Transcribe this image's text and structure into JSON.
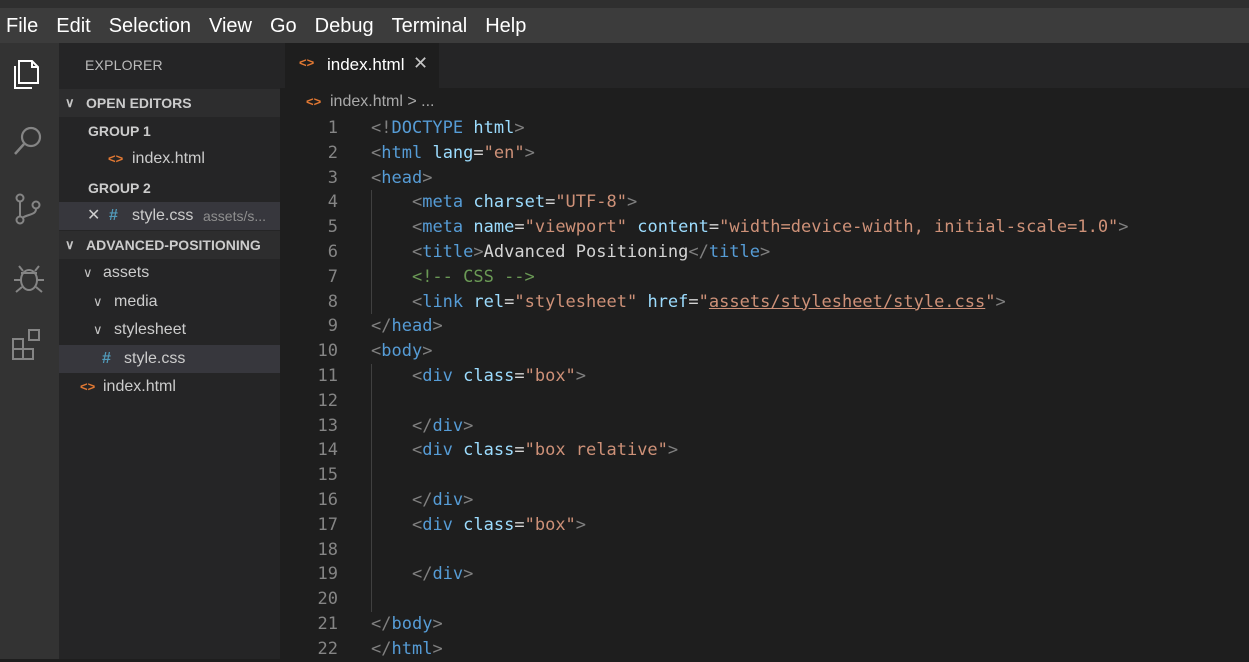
{
  "menu": [
    "File",
    "Edit",
    "Selection",
    "View",
    "Go",
    "Debug",
    "Terminal",
    "Help"
  ],
  "explorer": {
    "title": "EXPLORER",
    "open_editors": "OPEN EDITORS",
    "group1": "GROUP 1",
    "group1_file": "index.html",
    "group2": "GROUP 2",
    "group2_file": "style.css",
    "group2_desc": "assets/s...",
    "folder": "ADVANCED-POSITIONING",
    "tree": {
      "assets": "assets",
      "media": "media",
      "stylesheet": "stylesheet",
      "style": "style.css",
      "index": "index.html"
    }
  },
  "tab": {
    "label": "index.html"
  },
  "breadcrumb": "index.html > ...",
  "icons": {
    "html": "<>",
    "css": "#",
    "chevron_down": "chevron-down-icon",
    "close": "close-icon"
  },
  "colors": {
    "tag": "#569cd6",
    "attr": "#9cdcfe",
    "string": "#ce9178",
    "comment": "#6a9955",
    "punct": "#808080"
  },
  "code": [
    [
      [
        "p",
        "<!"
      ],
      [
        "t",
        "DOCTYPE"
      ],
      [
        "x",
        " "
      ],
      [
        "a",
        "html"
      ],
      [
        "p",
        ">"
      ]
    ],
    [
      [
        "p",
        "<"
      ],
      [
        "t",
        "html"
      ],
      [
        "x",
        " "
      ],
      [
        "a",
        "lang"
      ],
      [
        "x",
        "="
      ],
      [
        "s",
        "\"en\""
      ],
      [
        "p",
        ">"
      ]
    ],
    [
      [
        "p",
        "<"
      ],
      [
        "t",
        "head"
      ],
      [
        "p",
        ">"
      ]
    ],
    [
      [
        "x",
        "    "
      ],
      [
        "p",
        "<"
      ],
      [
        "t",
        "meta"
      ],
      [
        "x",
        " "
      ],
      [
        "a",
        "charset"
      ],
      [
        "x",
        "="
      ],
      [
        "s",
        "\"UTF-8\""
      ],
      [
        "p",
        ">"
      ]
    ],
    [
      [
        "x",
        "    "
      ],
      [
        "p",
        "<"
      ],
      [
        "t",
        "meta"
      ],
      [
        "x",
        " "
      ],
      [
        "a",
        "name"
      ],
      [
        "x",
        "="
      ],
      [
        "s",
        "\"viewport\""
      ],
      [
        "x",
        " "
      ],
      [
        "a",
        "content"
      ],
      [
        "x",
        "="
      ],
      [
        "s",
        "\"width=device-width, initial-scale=1.0\""
      ],
      [
        "p",
        ">"
      ]
    ],
    [
      [
        "x",
        "    "
      ],
      [
        "p",
        "<"
      ],
      [
        "t",
        "title"
      ],
      [
        "p",
        ">"
      ],
      [
        "x",
        "Advanced Positioning"
      ],
      [
        "p",
        "</"
      ],
      [
        "t",
        "title"
      ],
      [
        "p",
        ">"
      ]
    ],
    [
      [
        "x",
        "    "
      ],
      [
        "c",
        "<!-- CSS -->"
      ]
    ],
    [
      [
        "x",
        "    "
      ],
      [
        "p",
        "<"
      ],
      [
        "t",
        "link"
      ],
      [
        "x",
        " "
      ],
      [
        "a",
        "rel"
      ],
      [
        "x",
        "="
      ],
      [
        "s",
        "\"stylesheet\""
      ],
      [
        "x",
        " "
      ],
      [
        "a",
        "href"
      ],
      [
        "x",
        "="
      ],
      [
        "s",
        "\""
      ],
      [
        "u",
        "assets/stylesheet/style.css"
      ],
      [
        "s",
        "\""
      ],
      [
        "p",
        ">"
      ]
    ],
    [
      [
        "p",
        "</"
      ],
      [
        "t",
        "head"
      ],
      [
        "p",
        ">"
      ]
    ],
    [
      [
        "p",
        "<"
      ],
      [
        "t",
        "body"
      ],
      [
        "p",
        ">"
      ]
    ],
    [
      [
        "x",
        "    "
      ],
      [
        "p",
        "<"
      ],
      [
        "t",
        "div"
      ],
      [
        "x",
        " "
      ],
      [
        "a",
        "class"
      ],
      [
        "x",
        "="
      ],
      [
        "s",
        "\"box\""
      ],
      [
        "p",
        ">"
      ]
    ],
    [],
    [
      [
        "x",
        "    "
      ],
      [
        "p",
        "</"
      ],
      [
        "t",
        "div"
      ],
      [
        "p",
        ">"
      ]
    ],
    [
      [
        "x",
        "    "
      ],
      [
        "p",
        "<"
      ],
      [
        "t",
        "div"
      ],
      [
        "x",
        " "
      ],
      [
        "a",
        "class"
      ],
      [
        "x",
        "="
      ],
      [
        "s",
        "\"box relative\""
      ],
      [
        "p",
        ">"
      ]
    ],
    [],
    [
      [
        "x",
        "    "
      ],
      [
        "p",
        "</"
      ],
      [
        "t",
        "div"
      ],
      [
        "p",
        ">"
      ]
    ],
    [
      [
        "x",
        "    "
      ],
      [
        "p",
        "<"
      ],
      [
        "t",
        "div"
      ],
      [
        "x",
        " "
      ],
      [
        "a",
        "class"
      ],
      [
        "x",
        "="
      ],
      [
        "s",
        "\"box\""
      ],
      [
        "p",
        ">"
      ]
    ],
    [],
    [
      [
        "x",
        "    "
      ],
      [
        "p",
        "</"
      ],
      [
        "t",
        "div"
      ],
      [
        "p",
        ">"
      ]
    ],
    [],
    [
      [
        "p",
        "</"
      ],
      [
        "t",
        "body"
      ],
      [
        "p",
        ">"
      ]
    ],
    [
      [
        "p",
        "</"
      ],
      [
        "t",
        "html"
      ],
      [
        "p",
        ">"
      ]
    ]
  ]
}
